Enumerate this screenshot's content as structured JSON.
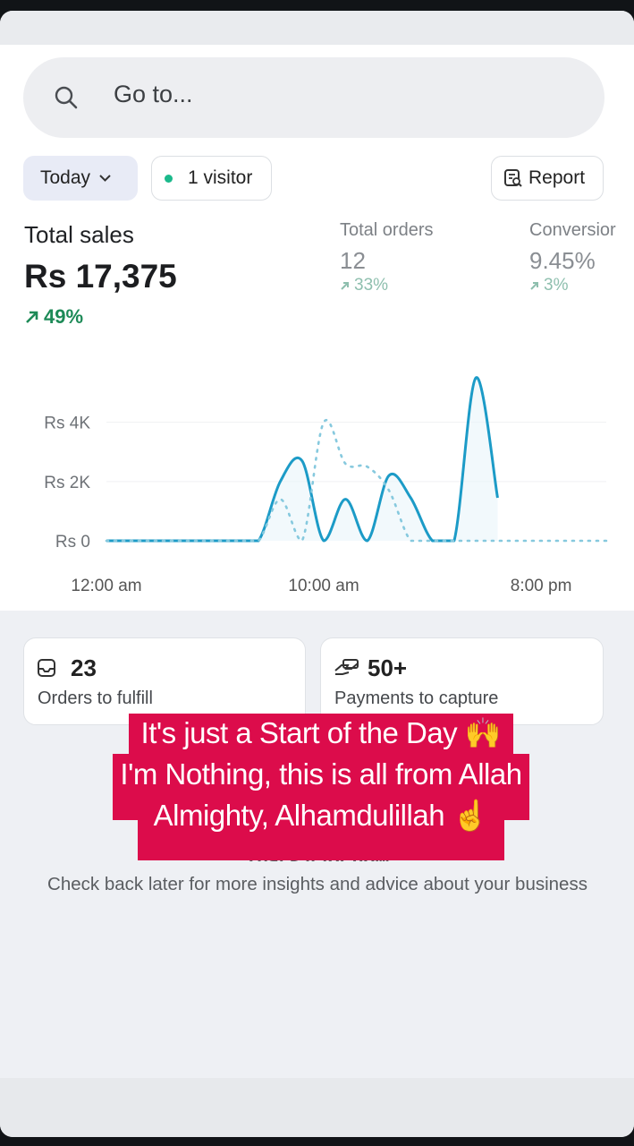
{
  "search": {
    "placeholder": "Go to..."
  },
  "filters": {
    "period": "Today",
    "visitors": "1 visitor",
    "report": "Report"
  },
  "metrics": {
    "total_sales": {
      "label": "Total sales",
      "value": "Rs 17,375",
      "delta": "49%"
    },
    "total_orders": {
      "label": "Total orders",
      "value": "12",
      "delta": "33%"
    },
    "conversion": {
      "label": "Conversior",
      "value": "9.45%",
      "delta": "3%"
    }
  },
  "chart_data": {
    "type": "line",
    "y_ticks": [
      "Rs 4K",
      "Rs 2K",
      "Rs 0"
    ],
    "x_ticks": [
      "12:00 am",
      "10:00 am",
      "8:00 pm"
    ],
    "ylim": [
      0,
      5500
    ],
    "x_hours": [
      0,
      1,
      2,
      3,
      4,
      5,
      6,
      7,
      8,
      9,
      10,
      11,
      12,
      13,
      14,
      15,
      16,
      17,
      18,
      19,
      20,
      21,
      22,
      23
    ],
    "series": [
      {
        "name": "",
        "style": "solid",
        "color": "#1c9bc7",
        "values": [
          0,
          0,
          0,
          0,
          0,
          0,
          0,
          0,
          2000,
          2700,
          0,
          1400,
          0,
          2200,
          1450,
          0,
          0,
          5500,
          1450,
          null,
          null,
          null,
          null,
          null
        ]
      },
      {
        "name": "",
        "style": "dotted",
        "color": "#86c9de",
        "values": [
          0,
          0,
          0,
          0,
          0,
          0,
          0,
          0,
          1400,
          0,
          4000,
          2600,
          2500,
          1700,
          0,
          0,
          0,
          0,
          0,
          0,
          0,
          0,
          0,
          0
        ]
      }
    ],
    "grid": true
  },
  "cards": [
    {
      "value": "23",
      "caption": "Orders to fulfill"
    },
    {
      "value": "50+",
      "caption": "Payments to capture"
    }
  ],
  "overlay": {
    "lines": [
      "It's just a Start of the Day 🙌",
      "I'm Nothing, this is all from Allah",
      "Almighty, Alhamdulillah ☝️"
    ],
    "background": "#dc0c4b"
  },
  "insights": {
    "heading": "That's it for now",
    "text": "Check back later for more insights and advice about your business"
  }
}
